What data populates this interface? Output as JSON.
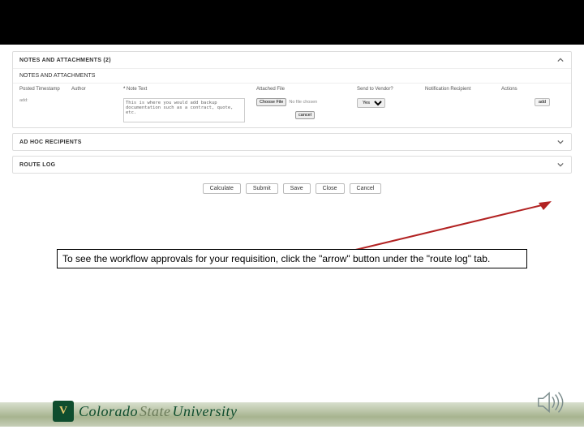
{
  "panels": {
    "notes_attachments": {
      "title": "NOTES AND ATTACHMENTS (2)",
      "subheading": "NOTES AND ATTACHMENTS",
      "columns": {
        "posted": "Posted Timestamp",
        "author": "Author",
        "note_text": "Note Text",
        "attached_file": "Attached File",
        "send_to_vendor": "Send to Vendor?",
        "notification_recipient": "Notification Recipient",
        "actions": "Actions"
      },
      "row": {
        "note_value": "This is where you would add backup documentation such as a contract, quote, etc.",
        "choose_file_label": "Choose File",
        "no_file_label": "No file chosen",
        "cancel_label": "cancel",
        "send_to_vendor_value": "Yes",
        "add_label": "add"
      },
      "add_row_label": "add:"
    },
    "ad_hoc": {
      "title": "AD HOC RECIPIENTS"
    },
    "route_log": {
      "title": "ROUTE LOG"
    }
  },
  "actions": {
    "calculate": "Calculate",
    "submit": "Submit",
    "save": "Save",
    "close": "Close",
    "cancel": "Cancel"
  },
  "annotation": {
    "text": "To see the workflow approvals for your requisition, click the \"arrow\" button under the \"route log\" tab."
  },
  "branding": {
    "name_part1": "Colorado",
    "name_part2": "State",
    "name_part3": "University",
    "mark": "V"
  },
  "colors": {
    "brand_green": "#0f4d2e",
    "arrow_red": "#b22222"
  }
}
